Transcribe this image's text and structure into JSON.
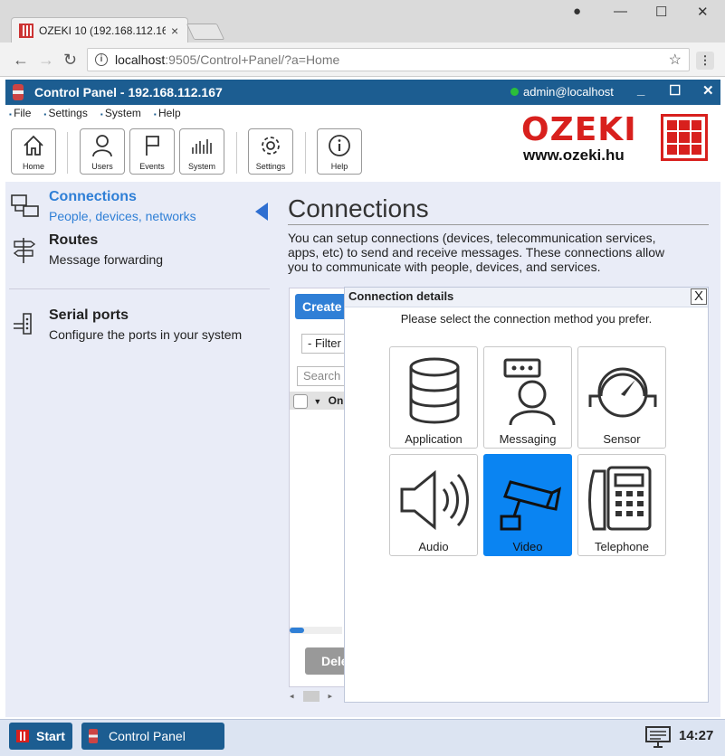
{
  "browser": {
    "tab_title": "OZEKI 10 (192.168.112.16",
    "tab_close": "×",
    "url_host": "localhost",
    "url_path": ":9505/Control+Panel/?a=Home",
    "controls": {
      "profile": "●",
      "minimize": "—",
      "maximize": "☐",
      "close": "✕"
    },
    "nav": {
      "back": "←",
      "forward": "→",
      "reload": "↻",
      "star": "☆",
      "menu": "⋮",
      "info": "i"
    }
  },
  "app": {
    "title": "Control Panel - 192.168.112.167",
    "user": "admin@localhost",
    "status_color": "#2bbf3a",
    "controls": {
      "minimize": "_",
      "maximize": "☐",
      "close": "✕"
    }
  },
  "menu": {
    "file": "File",
    "settings": "Settings",
    "system": "System",
    "help": "Help"
  },
  "toolbar": {
    "home": "Home",
    "users": "Users",
    "events": "Events",
    "system": "System",
    "settings": "Settings",
    "help": "Help"
  },
  "brand": {
    "name": "OZEKI",
    "url": "www.ozeki.hu",
    "color": "#d8201d"
  },
  "sidebar": {
    "items": [
      {
        "title": "Connections",
        "subtitle": "People, devices, networks",
        "active": true,
        "icon": "connections-icon"
      },
      {
        "title": "Routes",
        "subtitle": "Message forwarding",
        "active": false,
        "icon": "signpost-icon"
      },
      {
        "title": "Serial ports",
        "subtitle": "Configure the ports in your system",
        "active": false,
        "icon": "serial-port-icon"
      }
    ]
  },
  "main": {
    "heading": "Connections",
    "description": "You can setup connections (devices, telecommunication services, apps, etc) to send and receive messages. These connections allow you to communicate with people, devices, and services.",
    "create_label": "Create",
    "filter_label": "- Filter",
    "search_placeholder": "Search",
    "column_label": "On",
    "delete_label": "Dele",
    "scroll_left": "◂",
    "scroll_right": "▸"
  },
  "dialog": {
    "title": "Connection details",
    "close": "X",
    "prompt": "Please select the connection method you prefer.",
    "options": [
      {
        "label": "Application",
        "icon": "database-icon",
        "selected": false
      },
      {
        "label": "Messaging",
        "icon": "messaging-user-icon",
        "selected": false
      },
      {
        "label": "Sensor",
        "icon": "gauge-icon",
        "selected": false
      },
      {
        "label": "Audio",
        "icon": "speaker-icon",
        "selected": false
      },
      {
        "label": "Video",
        "icon": "camera-icon",
        "selected": true
      },
      {
        "label": "Telephone",
        "icon": "telephone-icon",
        "selected": false
      }
    ],
    "selected_color": "#0a84f2"
  },
  "taskbar": {
    "start": "Start",
    "control_panel": "Control Panel",
    "time": "14:27"
  }
}
